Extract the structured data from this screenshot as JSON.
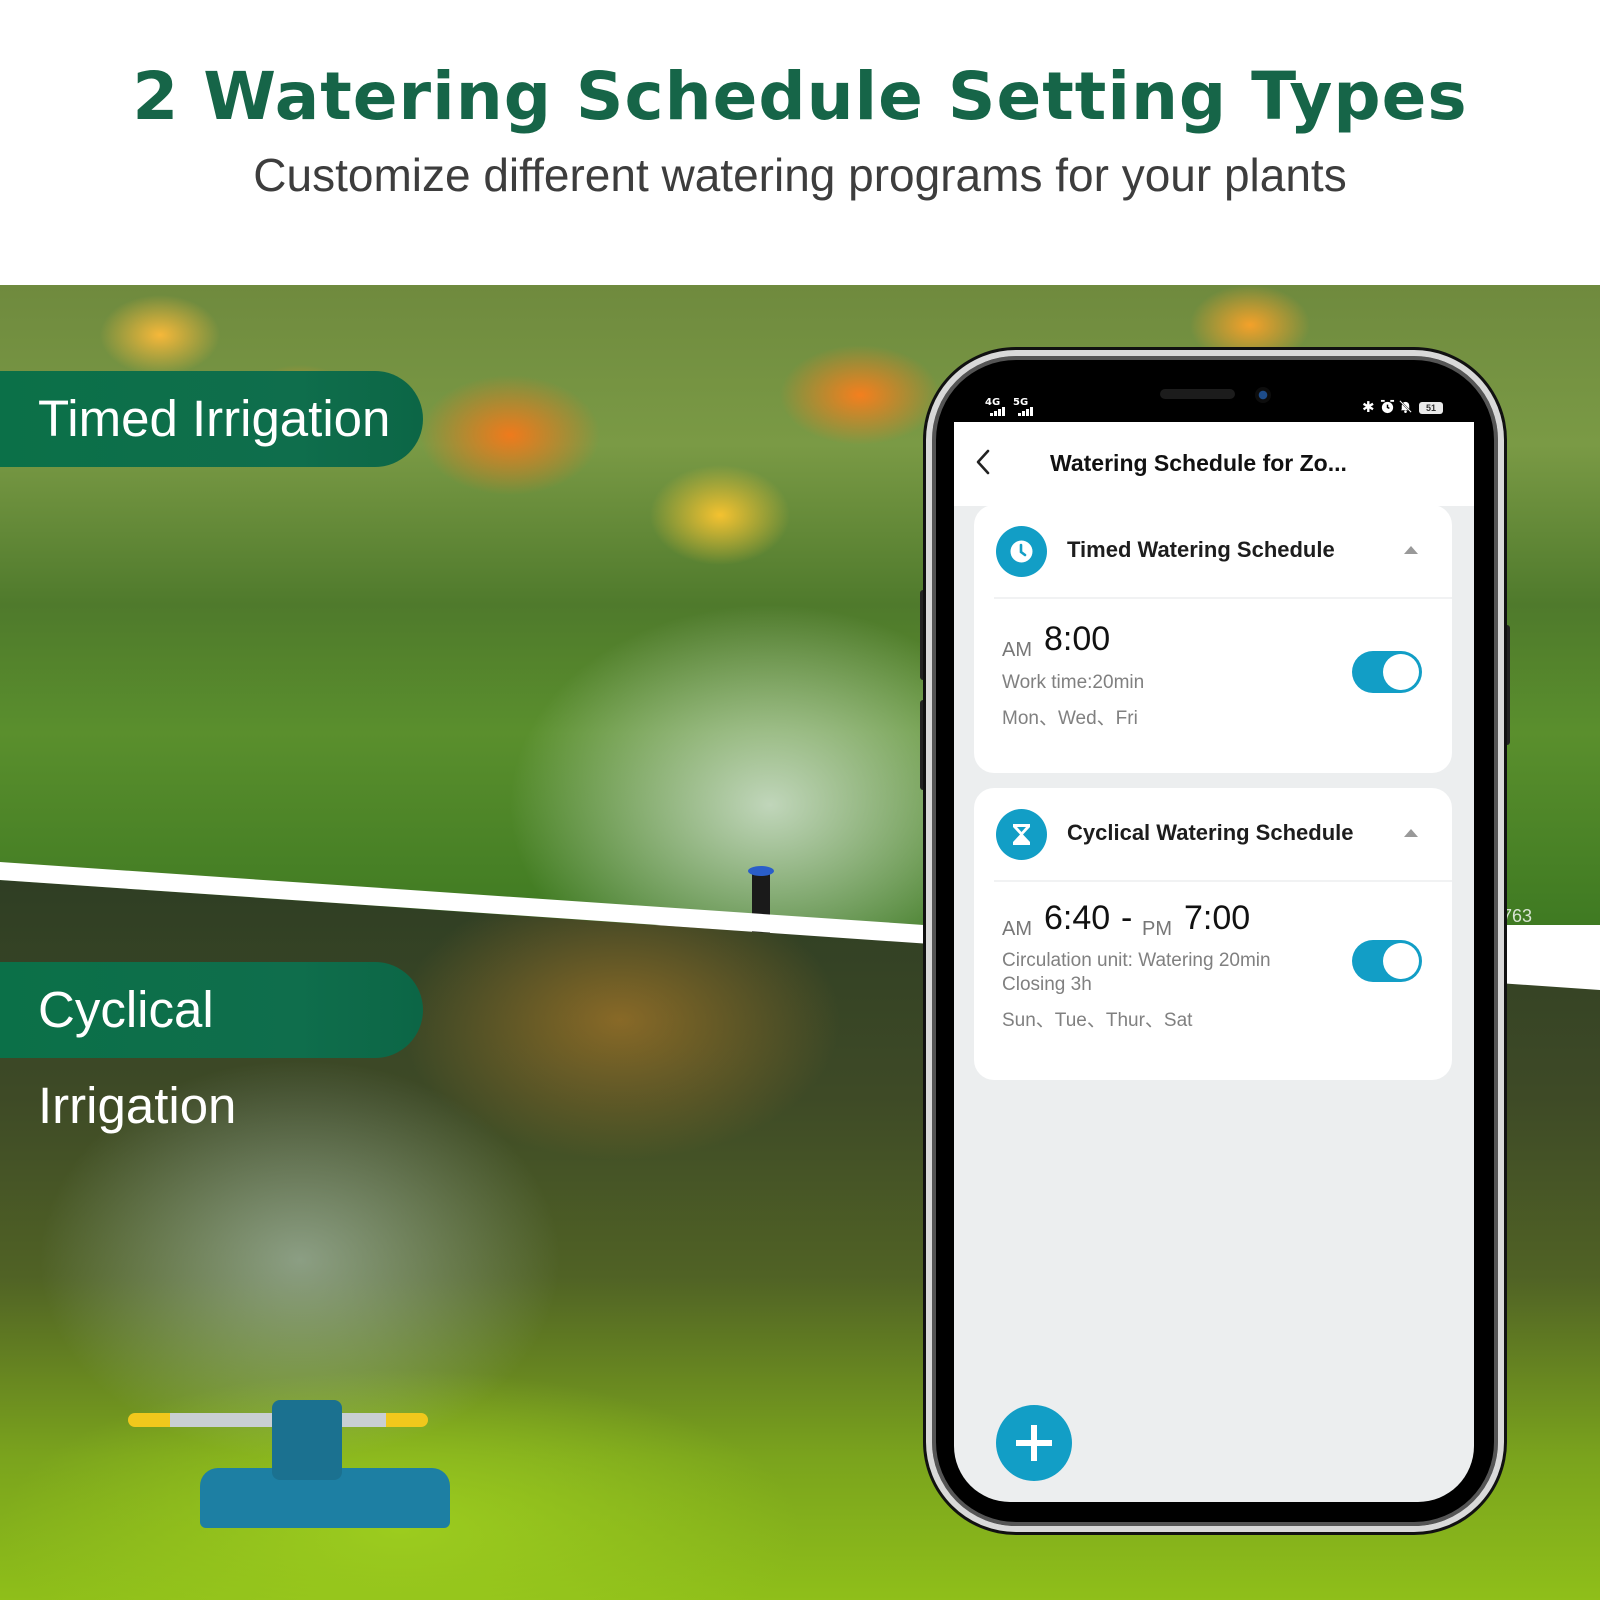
{
  "header": {
    "headline": "2 Watering Schedule Setting Types",
    "subline": "Customize different watering programs for your plants"
  },
  "labels": {
    "timed": "Timed Irrigation",
    "cyclical": "Cyclical Irrigation"
  },
  "watermark": "763",
  "phone": {
    "status_bar": {
      "network_1": "4G",
      "network_2": "5G",
      "icons": [
        "bluetooth-icon",
        "alarm-icon",
        "mute-bell-icon"
      ],
      "bluetooth": "✱",
      "alarm": "⏰",
      "bell": "🔕",
      "battery": "51"
    },
    "nav": {
      "title": "Watering Schedule for Zo..."
    },
    "schedules": [
      {
        "type": "timed",
        "title": "Timed Watering Schedule",
        "icon": "clock-icon",
        "start_period": "AM",
        "start_time": "8:00",
        "work_time": "Work time:20min",
        "days": "Mon、Wed、Fri",
        "enabled": true
      },
      {
        "type": "cyclical",
        "title": "Cyclical Watering Schedule",
        "icon": "hourglass-icon",
        "start_period": "AM",
        "start_time": "6:40",
        "separator": "-",
        "end_period": "PM",
        "end_time": "7:00",
        "circulation_line_1": "Circulation unit: Watering 20min",
        "circulation_line_2": "Closing 3h",
        "days": "Sun、Tue、Thur、Sat",
        "enabled": true
      }
    ],
    "fab_icon": "plus-icon"
  },
  "colors": {
    "headline_green": "#166548",
    "pill_green": "#0b7048",
    "accent_blue": "#129ec6",
    "screen_bg": "#eceeef"
  }
}
